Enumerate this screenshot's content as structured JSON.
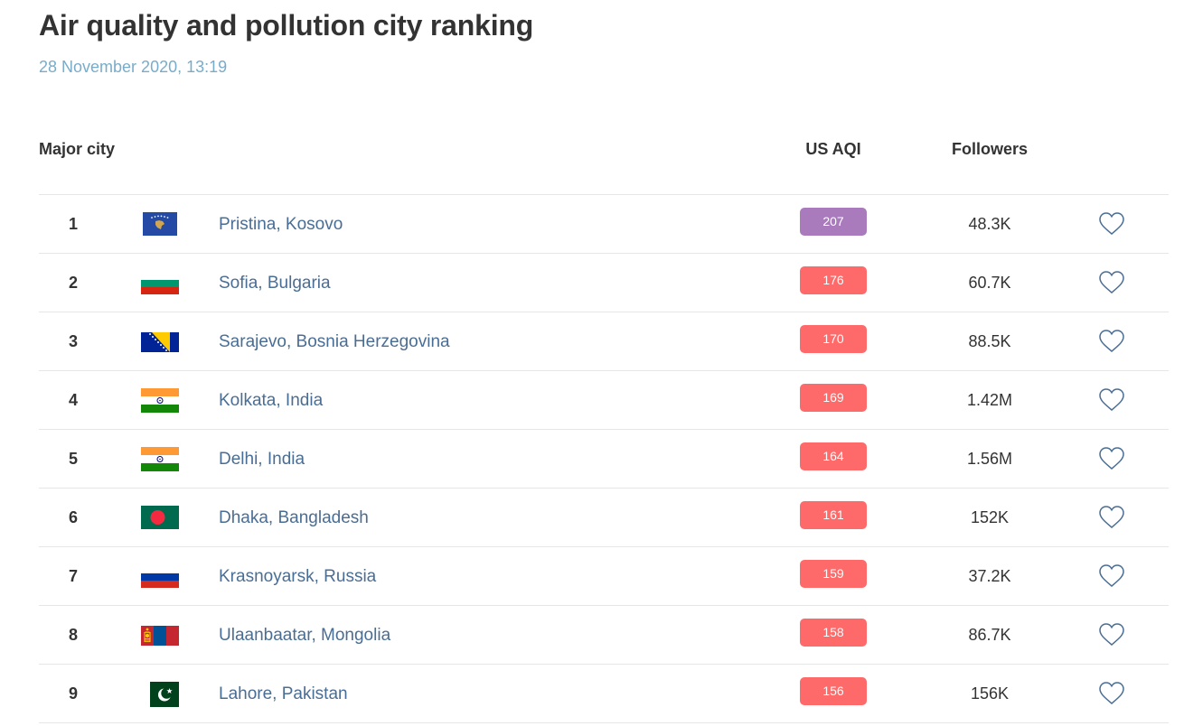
{
  "page": {
    "title": "Air quality and pollution city ranking",
    "date": "28 November 2020, 13:19"
  },
  "table": {
    "headers": {
      "city": "Major city",
      "aqi": "US AQI",
      "followers": "Followers"
    },
    "rows": [
      {
        "rank": "1",
        "city": "Pristina, Kosovo",
        "aqi": "207",
        "aqi_color": "#a97abc",
        "followers": "48.3K",
        "flag": "kosovo-flag-icon"
      },
      {
        "rank": "2",
        "city": "Sofia, Bulgaria",
        "aqi": "176",
        "aqi_color": "#fe6a69",
        "followers": "60.7K",
        "flag": "bulgaria-flag-icon"
      },
      {
        "rank": "3",
        "city": "Sarajevo, Bosnia Herzegovina",
        "aqi": "170",
        "aqi_color": "#fe6a69",
        "followers": "88.5K",
        "flag": "bosnia-flag-icon"
      },
      {
        "rank": "4",
        "city": "Kolkata, India",
        "aqi": "169",
        "aqi_color": "#fe6a69",
        "followers": "1.42M",
        "flag": "india-flag-icon"
      },
      {
        "rank": "5",
        "city": "Delhi, India",
        "aqi": "164",
        "aqi_color": "#fe6a69",
        "followers": "1.56M",
        "flag": "india-flag-icon"
      },
      {
        "rank": "6",
        "city": "Dhaka, Bangladesh",
        "aqi": "161",
        "aqi_color": "#fe6a69",
        "followers": "152K",
        "flag": "bangladesh-flag-icon"
      },
      {
        "rank": "7",
        "city": "Krasnoyarsk, Russia",
        "aqi": "159",
        "aqi_color": "#fe6a69",
        "followers": "37.2K",
        "flag": "russia-flag-icon"
      },
      {
        "rank": "8",
        "city": "Ulaanbaatar, Mongolia",
        "aqi": "158",
        "aqi_color": "#fe6a69",
        "followers": "86.7K",
        "flag": "mongolia-flag-icon"
      },
      {
        "rank": "9",
        "city": "Lahore, Pakistan",
        "aqi": "156",
        "aqi_color": "#fe6a69",
        "followers": "156K",
        "flag": "pakistan-flag-icon"
      }
    ]
  },
  "icons": {
    "follow": "heart-icon"
  },
  "colors": {
    "title": "#333333",
    "date": "#79acc9",
    "city_link": "#4a6d94",
    "aqi_very_unhealthy": "#a97abc",
    "aqi_unhealthy": "#fe6a69",
    "heart_outline": "#4a6d94"
  }
}
